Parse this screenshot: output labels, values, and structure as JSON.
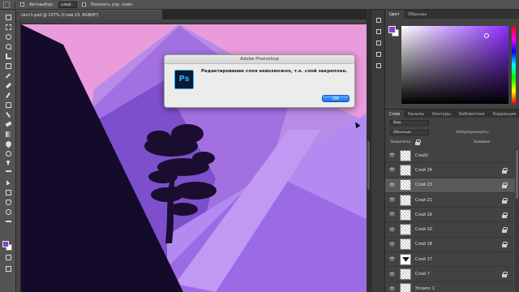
{
  "options_bar": {
    "autoselect_label": "Автовыбор:",
    "autoselect_value": "слой",
    "show_transform_label": "Показать упр. элем."
  },
  "document": {
    "tab_title": "сkхт1.psd @ 157% (Слой 23, RGB/8*)"
  },
  "dialog": {
    "title": "Adobe Photoshop",
    "icon_text": "Ps",
    "message": "Редактирование слоя невозможно, т.к. слой закреплен.",
    "ok_label": "OK"
  },
  "color_panel": {
    "tabs": [
      "Цвет",
      "Образцы"
    ],
    "foreground": "#7b47c9",
    "background": "#ffffff",
    "hue_color": "#8c2eff"
  },
  "layers_panel": {
    "tabs": [
      "Слои",
      "Каналы",
      "Контуры",
      "Библиотеки",
      "Коррекция"
    ],
    "filter_value": "Вид",
    "mode_value": "Обычные",
    "opacity_label": "Непрозрачность:",
    "lock_label": "Закрепить:",
    "fill_label": "Заливка:",
    "layers": [
      {
        "name": "Слой2",
        "locked": false,
        "selected": false,
        "thumb": "checker"
      },
      {
        "name": "Слой 24",
        "locked": true,
        "selected": false,
        "thumb": "checker"
      },
      {
        "name": "Слой 23",
        "locked": true,
        "selected": true,
        "thumb": "checker"
      },
      {
        "name": "Слой 21",
        "locked": true,
        "selected": false,
        "thumb": "checker"
      },
      {
        "name": "Слой 16",
        "locked": true,
        "selected": false,
        "thumb": "checker"
      },
      {
        "name": "Слой 20",
        "locked": true,
        "selected": false,
        "thumb": "checker"
      },
      {
        "name": "Слой 18",
        "locked": true,
        "selected": false,
        "thumb": "checker"
      },
      {
        "name": "Слой 17",
        "locked": false,
        "selected": false,
        "thumb": "dark"
      },
      {
        "name": "Слой 7",
        "locked": true,
        "selected": false,
        "thumb": "checker"
      },
      {
        "name": "Эллипс 1",
        "locked": false,
        "selected": false,
        "thumb": "checker"
      }
    ]
  },
  "colors": {
    "sky": "#e99bdb",
    "mountain_light": "#a77ae6",
    "mountain_mid": "#8c5fd6",
    "mountain_dark": "#6a3db8",
    "cliff": "#140a2a",
    "tree": "#1a0d30"
  }
}
